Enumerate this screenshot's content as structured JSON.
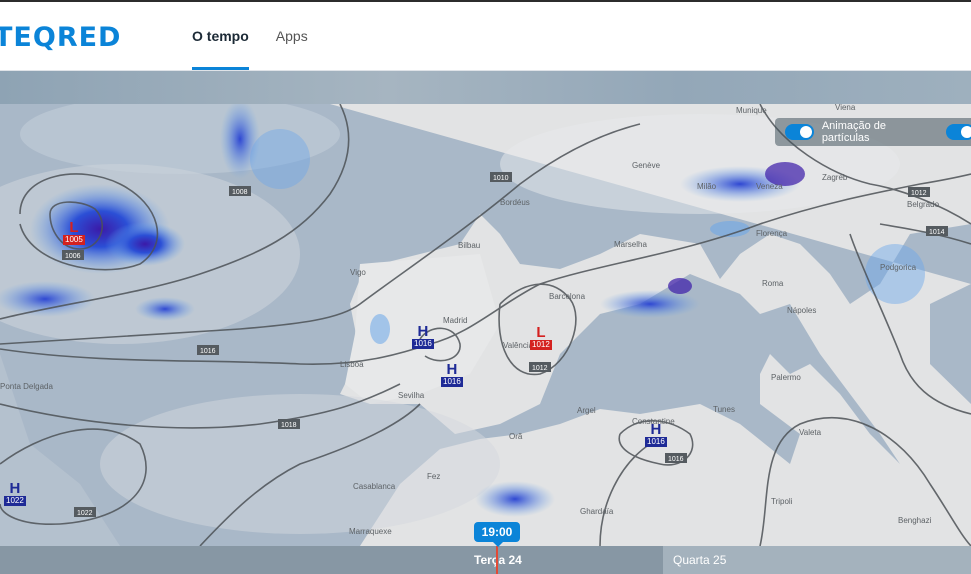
{
  "header": {
    "logo": "TEQRED",
    "nav": [
      {
        "label": "O tempo",
        "active": true
      },
      {
        "label": "Apps",
        "active": false
      }
    ]
  },
  "map": {
    "cities": [
      "Munique",
      "Viena",
      "Genève",
      "Milão",
      "Veneza",
      "Zagreb",
      "Belgrado",
      "Bordéus",
      "Marselha",
      "Florença",
      "Vigo",
      "Bilbau",
      "Barcelona",
      "Roma",
      "Podgorica",
      "Madrid",
      "Valência",
      "Nápoles",
      "Lisboa",
      "Sevilha",
      "Palermo",
      "Ponta Delgada",
      "Argel",
      "Tunes",
      "Constantine",
      "Valeta",
      "Orã",
      "Casablanca",
      "Fez",
      "Ghardaïa",
      "Marraquexe",
      "Tripoli",
      "Benghazi"
    ],
    "isobars": [
      "1008",
      "1010",
      "1006",
      "1012",
      "1014",
      "1016",
      "1018",
      "1022"
    ],
    "pressure_systems": [
      {
        "type": "L",
        "value": "1005"
      },
      {
        "type": "L",
        "value": "1012"
      },
      {
        "type": "H",
        "value": "1016"
      },
      {
        "type": "H",
        "value": "1016"
      },
      {
        "type": "H",
        "value": "1016"
      },
      {
        "type": "H",
        "value": "1022"
      }
    ],
    "particle_toggle_label": "Animação de partículas"
  },
  "timeline": {
    "current_time": "19:00",
    "days": [
      "Terça 24",
      "Quarta 25"
    ]
  }
}
